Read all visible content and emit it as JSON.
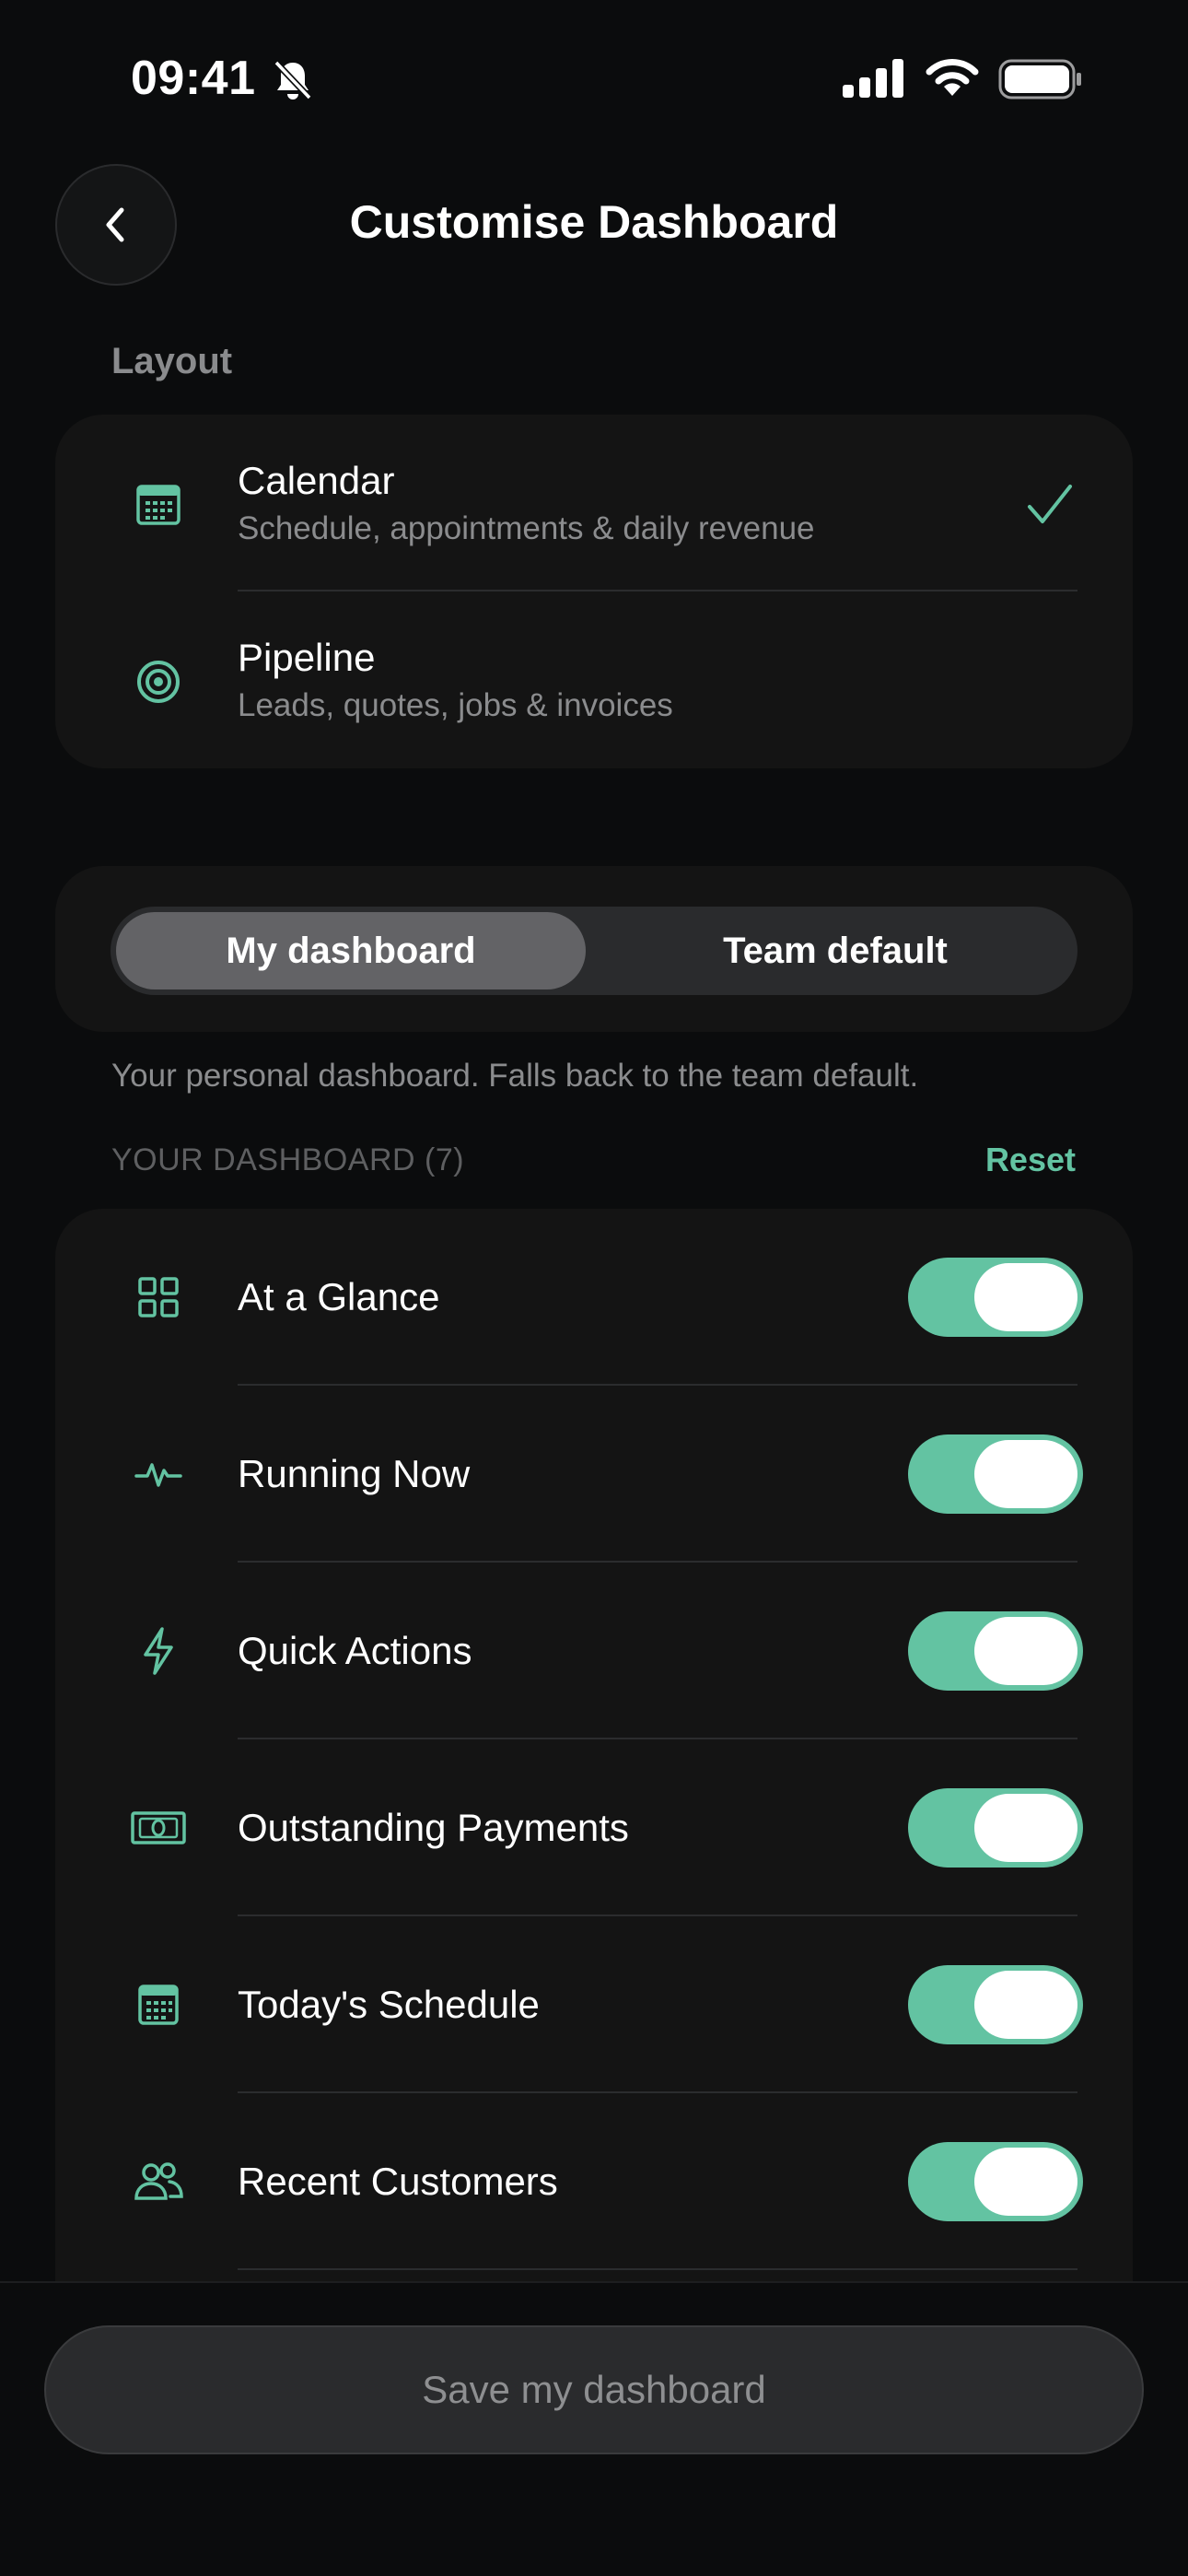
{
  "status_bar": {
    "time": "09:41",
    "icons": [
      "bell-slash-icon",
      "signal-icon",
      "wifi-icon",
      "battery-icon"
    ]
  },
  "header": {
    "title": "Customise Dashboard",
    "back_icon": "chevron-left-icon"
  },
  "layout_section": {
    "label": "Layout",
    "options": [
      {
        "title": "Calendar",
        "subtitle": "Schedule, appointments & daily revenue",
        "icon": "calendar-icon",
        "selected": true
      },
      {
        "title": "Pipeline",
        "subtitle": "Leads, quotes, jobs & invoices",
        "icon": "target-icon",
        "selected": false
      }
    ]
  },
  "segmented": {
    "options": [
      "My dashboard",
      "Team default"
    ],
    "selected": "My dashboard"
  },
  "hint": "Your personal dashboard. Falls back to the team default.",
  "dashboard": {
    "header": "YOUR DASHBOARD (7)",
    "reset_label": "Reset",
    "widgets": [
      {
        "label": "At a Glance",
        "icon": "grid-icon",
        "enabled": true
      },
      {
        "label": "Running Now",
        "icon": "pulse-icon",
        "enabled": true
      },
      {
        "label": "Quick Actions",
        "icon": "lightning-icon",
        "enabled": true
      },
      {
        "label": "Outstanding Payments",
        "icon": "banknote-icon",
        "enabled": true
      },
      {
        "label": "Today's Schedule",
        "icon": "calendar-icon",
        "enabled": true
      },
      {
        "label": "Recent Customers",
        "icon": "users-icon",
        "enabled": true
      }
    ]
  },
  "save_button": {
    "label": "Save my dashboard"
  },
  "colors": {
    "accent": "#63c3a2",
    "background": "#0b0c0d",
    "card": "#141414",
    "muted_text": "#8b8c8e"
  }
}
